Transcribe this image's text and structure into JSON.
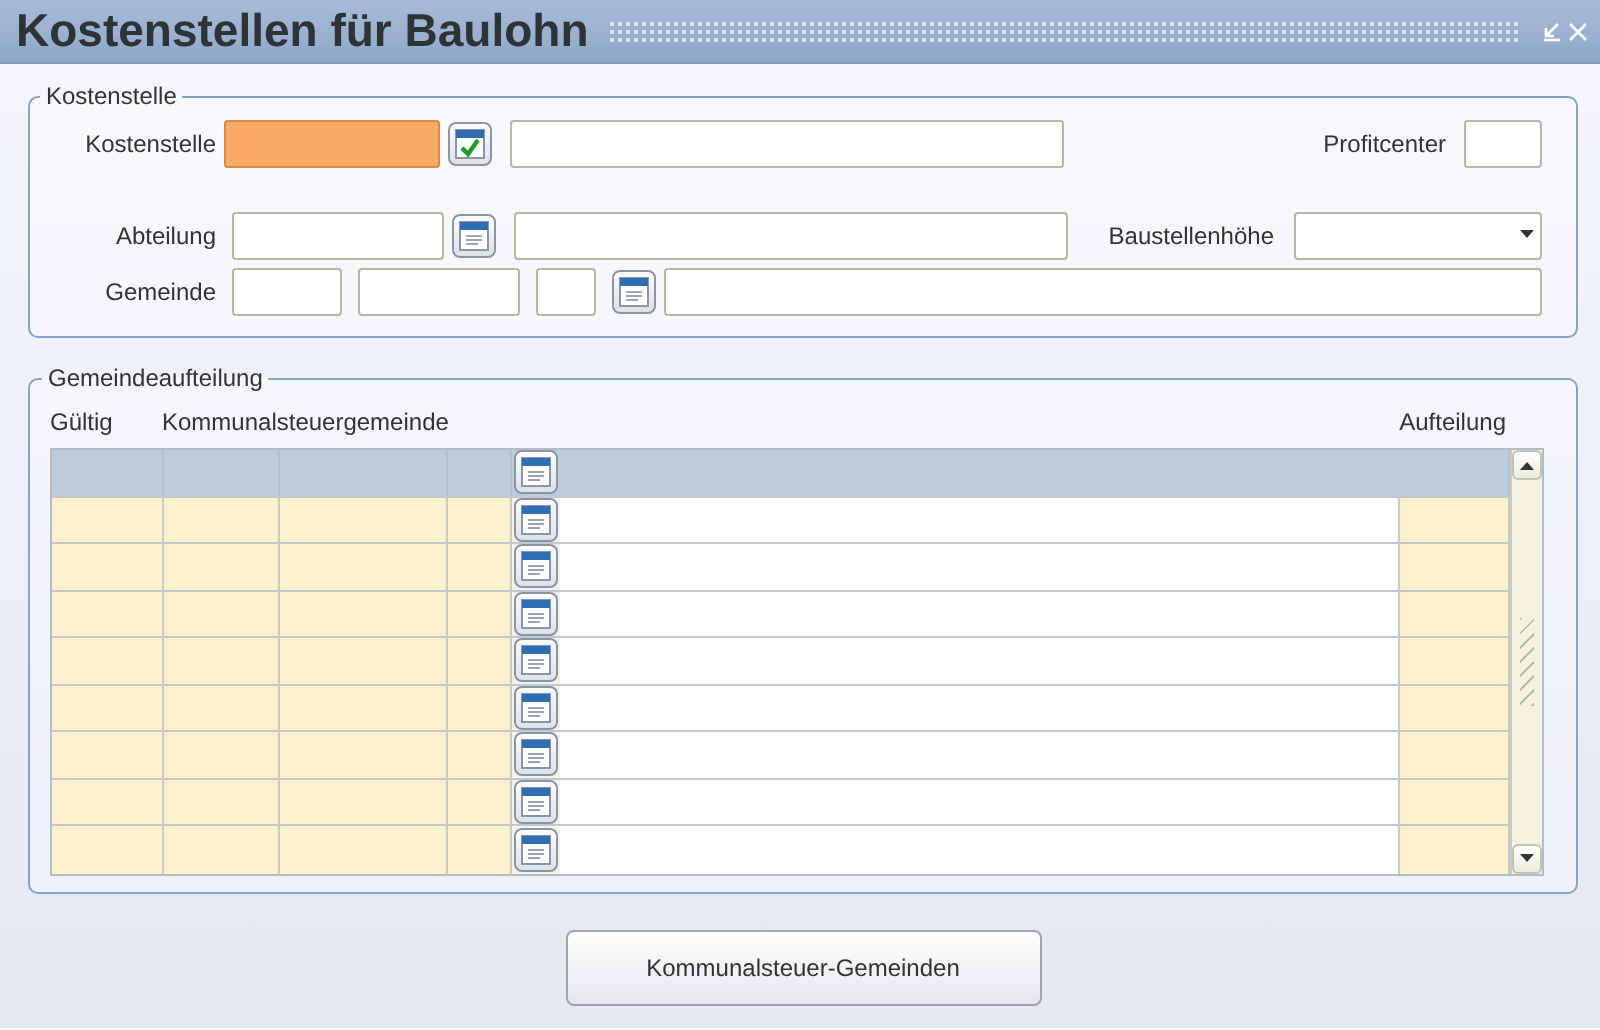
{
  "window": {
    "title": "Kostenstellen für Baulohn"
  },
  "kostenstelle": {
    "legend": "Kostenstelle",
    "kostenstelle_label": "Kostenstelle",
    "kostenstelle_focused": true,
    "profitcenter_label": "Profitcenter",
    "abteilung_label": "Abteilung",
    "baustellenhoehe_label": "Baustellenhöhe",
    "gemeinde_label": "Gemeinde"
  },
  "gemeindeaufteilung": {
    "legend": "Gemeindeaufteilung",
    "columns": [
      "Gültig",
      "Kommunalsteuergemeinde",
      "Aufteilung"
    ],
    "rows": [
      {
        "selected": true
      },
      {
        "selected": false
      },
      {
        "selected": false
      },
      {
        "selected": false
      },
      {
        "selected": false
      },
      {
        "selected": false
      },
      {
        "selected": false
      },
      {
        "selected": false
      },
      {
        "selected": false
      }
    ]
  },
  "buttons": [
    "Kommunalsteuer-Gemeinden"
  ]
}
